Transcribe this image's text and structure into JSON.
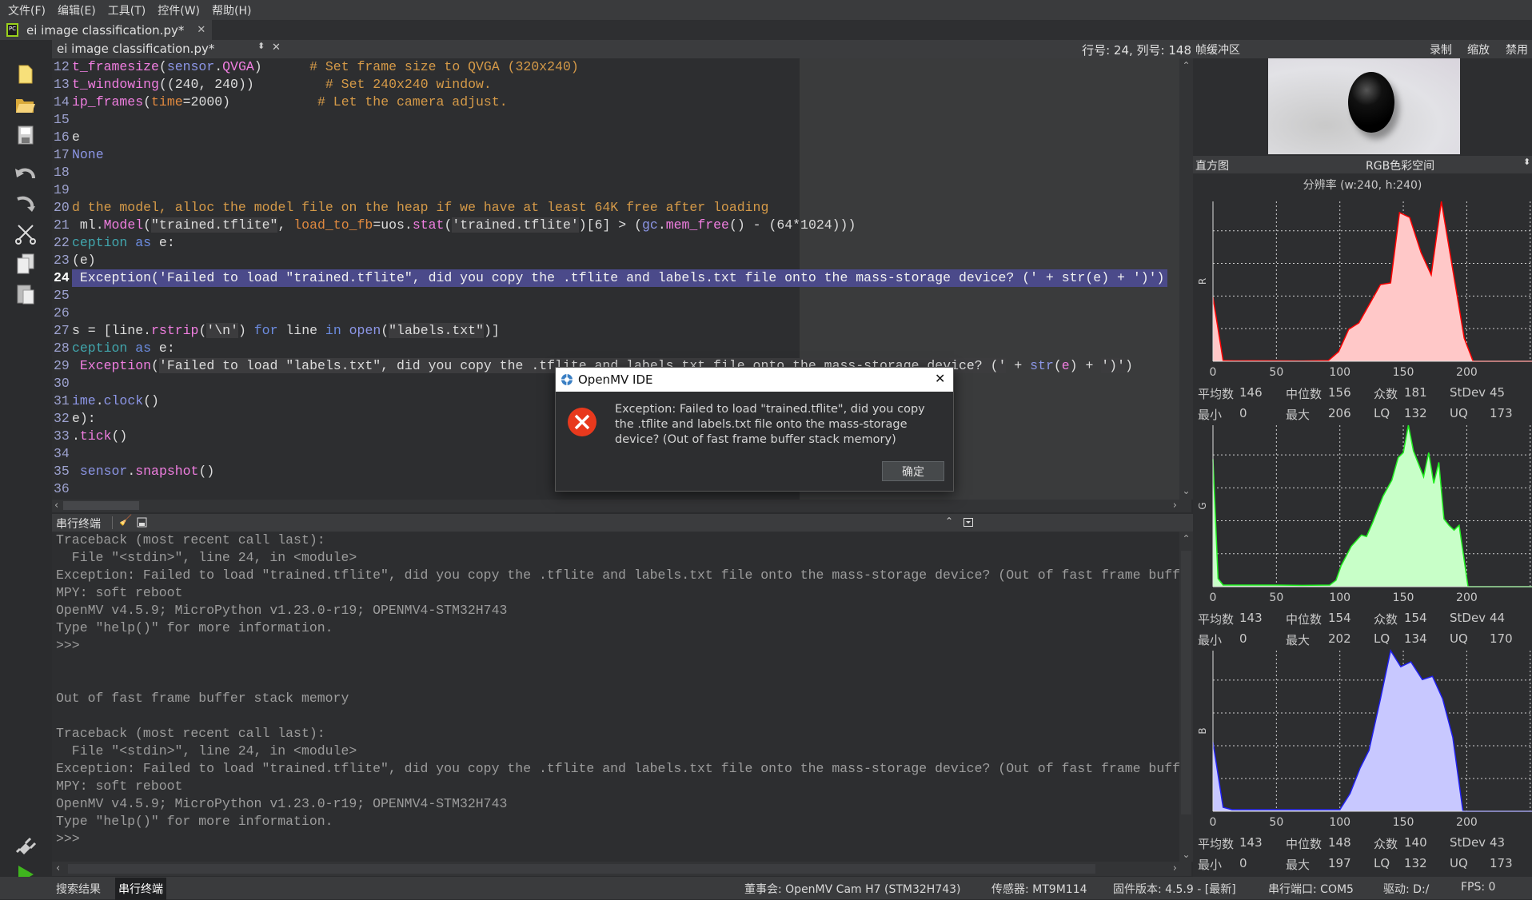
{
  "menu": [
    "文件(F)",
    "编辑(E)",
    "工具(T)",
    "控件(W)",
    "帮助(H)"
  ],
  "file_tab": {
    "label": "ei image classification.py*",
    "close": "✕"
  },
  "editor": {
    "file_label": "ei image classification.py*",
    "position": "行号: 24, 列号: 148",
    "highlight_line": "24",
    "lines": [
      {
        "n": "12",
        "tokens": [
          [
            "t_framesize",
            "fn"
          ],
          [
            "(",
            "tx"
          ],
          [
            "sensor",
            "id"
          ],
          [
            ".",
            "tx"
          ],
          [
            "QVGA",
            "fn"
          ],
          [
            ")",
            "tx"
          ],
          [
            "      ",
            "tx"
          ],
          [
            "# Set frame size to QVGA (320x240)",
            "cm"
          ]
        ]
      },
      {
        "n": "13",
        "tokens": [
          [
            "t_windowing",
            "fn"
          ],
          [
            "((240, 240))",
            "tx"
          ],
          [
            "         ",
            "tx"
          ],
          [
            "# Set 240x240 window.",
            "cm"
          ]
        ]
      },
      {
        "n": "14",
        "tokens": [
          [
            "ip_frames",
            "fn"
          ],
          [
            "(",
            "tx"
          ],
          [
            "time",
            "kv"
          ],
          [
            "=2000)",
            "tx"
          ],
          [
            "           ",
            "tx"
          ],
          [
            "# Let the camera adjust.",
            "cm"
          ]
        ]
      },
      {
        "n": "15",
        "tokens": []
      },
      {
        "n": "16",
        "tokens": [
          [
            "e",
            "tx"
          ]
        ]
      },
      {
        "n": "17",
        "tokens": [
          [
            "None",
            "id"
          ]
        ]
      },
      {
        "n": "18",
        "tokens": []
      },
      {
        "n": "19",
        "tokens": []
      },
      {
        "n": "20",
        "tokens": [
          [
            "d the model, alloc the model file on the heap if we have at least 64K free after loading",
            "cm"
          ]
        ]
      },
      {
        "n": "21",
        "tokens": [
          [
            " ml.",
            "tx"
          ],
          [
            "Model",
            "fn"
          ],
          [
            "(",
            "tx"
          ],
          [
            "\"trained.tflite\"",
            "st"
          ],
          [
            ", ",
            "tx"
          ],
          [
            "load_to_fb",
            "kv"
          ],
          [
            "=uos.",
            "tx"
          ],
          [
            "stat",
            "fn"
          ],
          [
            "(",
            "tx"
          ],
          [
            "'trained.tflite'",
            "st"
          ],
          [
            ")[6] > (",
            "tx"
          ],
          [
            "gc",
            "id"
          ],
          [
            ".",
            "tx"
          ],
          [
            "mem_free",
            "fn"
          ],
          [
            "() - (64*1024)))",
            "tx"
          ]
        ]
      },
      {
        "n": "22",
        "tokens": [
          [
            "ception",
            "ex"
          ],
          [
            " ",
            "tx"
          ],
          [
            "as",
            "kw"
          ],
          [
            " e:",
            "tx"
          ]
        ]
      },
      {
        "n": "23",
        "tokens": [
          [
            "(e)",
            "tx"
          ]
        ]
      },
      {
        "n": "24",
        "tokens": [
          [
            " Exception('Failed to load \"trained.tflite\", did you copy the .tflite and labels.txt file onto the mass-storage device? (' + str(e) + ')')",
            "tx"
          ]
        ]
      },
      {
        "n": "25",
        "tokens": []
      },
      {
        "n": "26",
        "tokens": []
      },
      {
        "n": "27",
        "tokens": [
          [
            "s = [line.",
            "tx"
          ],
          [
            "rstrip",
            "fn"
          ],
          [
            "(",
            "tx"
          ],
          [
            "'\\n'",
            "st"
          ],
          [
            ") ",
            "tx"
          ],
          [
            "for",
            "kw"
          ],
          [
            " line ",
            "tx"
          ],
          [
            "in",
            "kw"
          ],
          [
            " ",
            "tx"
          ],
          [
            "open",
            "id"
          ],
          [
            "(",
            "tx"
          ],
          [
            "\"labels.txt\"",
            "st"
          ],
          [
            ")]",
            "tx"
          ]
        ]
      },
      {
        "n": "28",
        "tokens": [
          [
            "ception",
            "ex"
          ],
          [
            " ",
            "tx"
          ],
          [
            "as",
            "kw"
          ],
          [
            " e:",
            "tx"
          ]
        ]
      },
      {
        "n": "29",
        "tokens": [
          [
            " ",
            "tx"
          ],
          [
            "Exception",
            "fn"
          ],
          [
            "(",
            "tx"
          ],
          [
            "'Failed to load \"labels.txt\", did you copy the .tflite and labels.txt file onto the mass-storage device? ('",
            "st"
          ],
          [
            " + ",
            "tx"
          ],
          [
            "str",
            "id"
          ],
          [
            "(",
            "tx"
          ],
          [
            "e",
            "fn"
          ],
          [
            ") + ",
            "tx"
          ],
          [
            "')'",
            "st"
          ],
          [
            ")",
            "tx"
          ]
        ]
      },
      {
        "n": "30",
        "tokens": []
      },
      {
        "n": "31",
        "tokens": [
          [
            "ime",
            "id"
          ],
          [
            ".",
            "tx"
          ],
          [
            "clock",
            "id"
          ],
          [
            "()",
            "tx"
          ]
        ]
      },
      {
        "n": "32",
        "tokens": [
          [
            "e):",
            "tx"
          ]
        ]
      },
      {
        "n": "33",
        "tokens": [
          [
            ".",
            "tx"
          ],
          [
            "tick",
            "fn"
          ],
          [
            "()",
            "tx"
          ]
        ]
      },
      {
        "n": "34",
        "tokens": []
      },
      {
        "n": "35",
        "tokens": [
          [
            " ",
            "tx"
          ],
          [
            "sensor",
            "id"
          ],
          [
            ".",
            "tx"
          ],
          [
            "snapshot",
            "fn"
          ],
          [
            "()",
            "tx"
          ]
        ]
      },
      {
        "n": "36",
        "tokens": []
      }
    ]
  },
  "terminal": {
    "title": "串行终端",
    "lines": [
      "Traceback (most recent call last):",
      "  File \"<stdin>\", line 24, in <module>",
      "Exception: Failed to load \"trained.tflite\", did you copy the .tflite and labels.txt file onto the mass-storage device? (Out of fast frame buffer stack memory)",
      "MPY: soft reboot",
      "OpenMV v4.5.9; MicroPython v1.23.0-r19; OPENMV4-STM32H743",
      "Type \"help()\" for more information.",
      ">>>",
      "",
      "",
      "Out of fast frame buffer stack memory",
      "",
      "Traceback (most recent call last):",
      "  File \"<stdin>\", line 24, in <module>",
      "Exception: Failed to load \"trained.tflite\", did you copy the .tflite and labels.txt file onto the mass-storage device? (Out of fast frame buffer stack memory)",
      "MPY: soft reboot",
      "OpenMV v4.5.9; MicroPython v1.23.0-r19; OPENMV4-STM32H743",
      "Type \"help()\" for more information.",
      ">>>"
    ]
  },
  "status": {
    "tabs": [
      "搜索结果",
      "串行终端"
    ],
    "board": "董事会: OpenMV Cam H7 (STM32H743)",
    "sensor": "传感器: MT9M114",
    "firmware": "固件版本: 4.5.9 - [最新]",
    "port": "串行端口: COM5",
    "drive": "驱动: D:/",
    "fps": "FPS: 0"
  },
  "framebuffer": {
    "title": "帧缓冲区",
    "record": "录制",
    "zoom": "缩放",
    "disable": "禁用"
  },
  "histogram": {
    "title": "直方图",
    "colorspace": "RGB色彩空间",
    "resolution": "分辨率 (w:240, h:240)"
  },
  "stat_labels": {
    "mean": "平均数",
    "median": "中位数",
    "mode": "众数",
    "stdev": "StDev",
    "min": "最小",
    "max": "最大",
    "lq": "LQ",
    "uq": "UQ"
  },
  "dialog": {
    "title": "OpenMV IDE",
    "message": "Exception: Failed to load \"trained.tflite\", did you copy the .tflite and labels.txt file onto the mass-storage device? (Out of fast frame buffer stack memory)",
    "ok": "确定",
    "close": "✕"
  },
  "chart_data": [
    {
      "type": "area",
      "ylabel": "R",
      "color": "#ff0000",
      "fill": "#ffc8c8",
      "xlim": [
        0,
        255
      ],
      "x_ticks": [
        "0",
        "50",
        "100",
        "150",
        "200"
      ],
      "grid": true,
      "x": [
        0,
        8,
        17,
        30,
        50,
        70,
        91,
        99,
        107,
        115,
        132,
        140,
        147,
        155,
        164,
        172,
        180,
        198,
        205,
        255
      ],
      "y": [
        40,
        0.5,
        0.3,
        0.4,
        0.3,
        0.2,
        0.5,
        6,
        20,
        24,
        48,
        49,
        93,
        90,
        68,
        54,
        100,
        14.5,
        0,
        0
      ],
      "stats": {
        "mean": "146",
        "median": "156",
        "mode": "181",
        "stdev": "45",
        "min": "0",
        "max": "206",
        "lq": "132",
        "uq": "173"
      }
    },
    {
      "type": "area",
      "ylabel": "G",
      "color": "#22ee22",
      "fill": "#c8ffc8",
      "xlim": [
        0,
        255
      ],
      "x_ticks": [
        "0",
        "50",
        "100",
        "150",
        "200"
      ],
      "grid": true,
      "x": [
        0,
        4,
        8,
        30,
        50,
        70,
        92,
        97,
        101,
        109,
        117,
        121,
        126,
        134,
        141,
        146,
        150,
        154,
        158,
        166,
        170,
        174,
        178,
        182,
        186,
        190,
        194,
        201,
        255
      ],
      "y": [
        79,
        5,
        1,
        1,
        1,
        0.8,
        1,
        4,
        13,
        25,
        32,
        31,
        40,
        56,
        66,
        80,
        83,
        100,
        84,
        68,
        83,
        64,
        77,
        42,
        38,
        35,
        38,
        0,
        0
      ],
      "stats": {
        "mean": "143",
        "median": "154",
        "mode": "154",
        "stdev": "44",
        "min": "0",
        "max": "202",
        "lq": "134",
        "uq": "170"
      }
    },
    {
      "type": "area",
      "ylabel": "B",
      "color": "#2020ee",
      "fill": "#c8c8ff",
      "xlim": [
        0,
        255
      ],
      "x_ticks": [
        "0",
        "50",
        "100",
        "150",
        "200"
      ],
      "grid": true,
      "x": [
        0,
        8,
        15,
        50,
        100,
        108,
        116,
        123,
        132,
        140,
        148,
        156,
        165,
        173,
        181,
        189,
        197,
        255
      ],
      "y": [
        43,
        2.5,
        1,
        1,
        1,
        11,
        27,
        38,
        70,
        100,
        90,
        93,
        82,
        84,
        70,
        46,
        0,
        0
      ],
      "stats": {
        "mean": "143",
        "median": "148",
        "mode": "140",
        "stdev": "43",
        "min": "0",
        "max": "197",
        "lq": "132",
        "uq": "173"
      }
    }
  ]
}
